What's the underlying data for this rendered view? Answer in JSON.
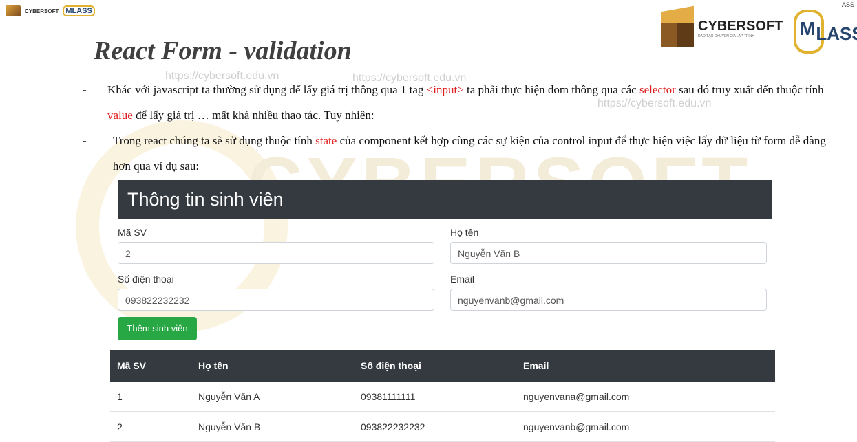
{
  "header": {
    "corner_brand": "CYBERSOFT",
    "corner_mark": "M",
    "corner_lass": "LASS",
    "right_corner": "ASS",
    "brand_name": "CYBERSOFT",
    "brand_sub": "ĐÀO TẠO CHUYÊN GIA LẬP TRÌNH",
    "mclass_m": "M",
    "mclass_lass": "LASS"
  },
  "watermarks": {
    "url_1": "https://cybersoft.edu.vn",
    "url_2": "https://cybersoft.edu.vn",
    "url_3": "https://cybersoft.edu.vn",
    "big": "CYBERSOFT"
  },
  "slide": {
    "title": "React Form - validation",
    "bullet_dash": "-",
    "b1_part1": "Khác với javascript ta thường sử dụng để lấy giá trị thông qua 1 tag ",
    "b1_red1": "<input>",
    "b1_part2": " ta phải thực hiện dom thông qua các ",
    "b1_red2": "selector",
    "b1_part3": " sau đó truy xuất đến thuộc tính ",
    "b1_red3": "value",
    "b1_part4": " để lấy giá trị … mất khá nhiều thao tác. Tuy nhiên:",
    "b2_part1": "Trong react chúng ta sẽ sử dụng thuộc tính ",
    "b2_red1": "state",
    "b2_part2": " của component kết hợp cùng các sự kiện của control input để thực hiện việc lấy dữ liệu từ form dễ dàng hơn qua ví dụ sau:"
  },
  "form": {
    "heading": "Thông tin sinh viên",
    "ma_sv_label": "Mã SV",
    "ma_sv_value": "2",
    "ho_ten_label": "Họ tên",
    "ho_ten_value": "Nguyễn Văn B",
    "sdt_label": "Số điện thoại",
    "sdt_value": "093822232232",
    "email_label": "Email",
    "email_value": "nguyenvanb@gmail.com",
    "submit_label": "Thêm sinh viên"
  },
  "table": {
    "columns": [
      "Mã SV",
      "Họ tên",
      "Số điện thoại",
      "Email"
    ],
    "rows": [
      [
        "1",
        "Nguyễn Văn A",
        "09381111111",
        "nguyenvana@gmail.com"
      ],
      [
        "2",
        "Nguyễn Văn B",
        "093822232232",
        "nguyenvanb@gmail.com"
      ]
    ]
  },
  "colors": {
    "accent_red": "#e01b1b",
    "dark_header": "#343a40",
    "button_green": "#28a745"
  }
}
